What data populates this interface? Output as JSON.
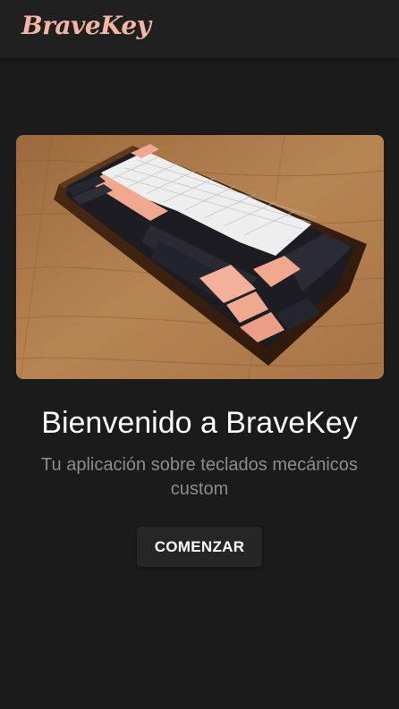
{
  "brand": {
    "name": "BraveKey"
  },
  "hero": {
    "image_name": "mechanical-keyboard-photo",
    "accent_color": "#f0a88f",
    "wood_color": "#b07a45"
  },
  "welcome": {
    "title": "Bienvenido a BraveKey",
    "subtitle": "Tu aplicación sobre teclados mecánicos custom"
  },
  "actions": {
    "start_label": "COMENZAR"
  },
  "colors": {
    "background": "#1b1b1b",
    "topbar": "#202020",
    "brand": "#f2b6a3",
    "subtitle": "#8c8c8c"
  }
}
